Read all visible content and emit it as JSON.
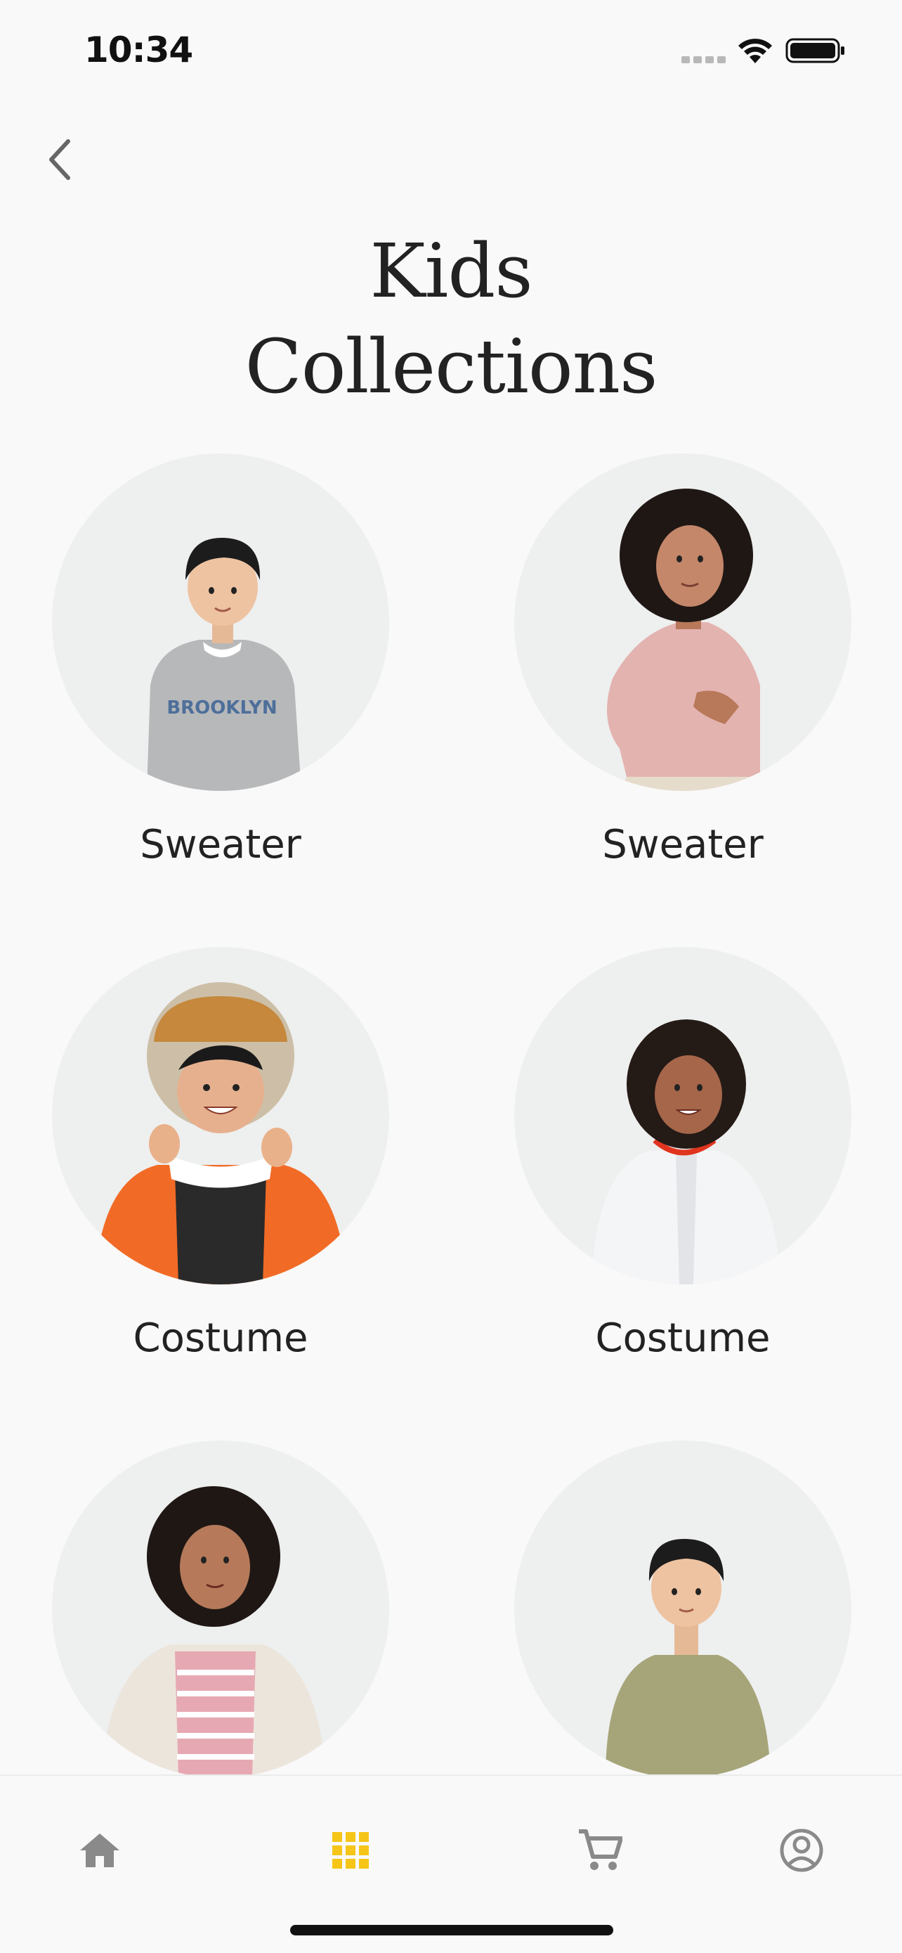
{
  "status_bar": {
    "time": "10:34"
  },
  "header": {
    "back_icon": "chevron-left-icon",
    "title_line1": "Kids",
    "title_line2": "Collections"
  },
  "categories": [
    {
      "label": "Sweater"
    },
    {
      "label": "Sweater"
    },
    {
      "label": "Costume"
    },
    {
      "label": "Costume"
    },
    {
      "label": ""
    },
    {
      "label": ""
    }
  ],
  "bottom_nav": {
    "items": [
      {
        "icon": "home-icon",
        "active": false
      },
      {
        "icon": "grid-icon",
        "active": true
      },
      {
        "icon": "cart-icon",
        "active": false
      },
      {
        "icon": "profile-icon",
        "active": false
      }
    ],
    "active_color": "#f5c518",
    "inactive_color": "#8a8a8a"
  }
}
